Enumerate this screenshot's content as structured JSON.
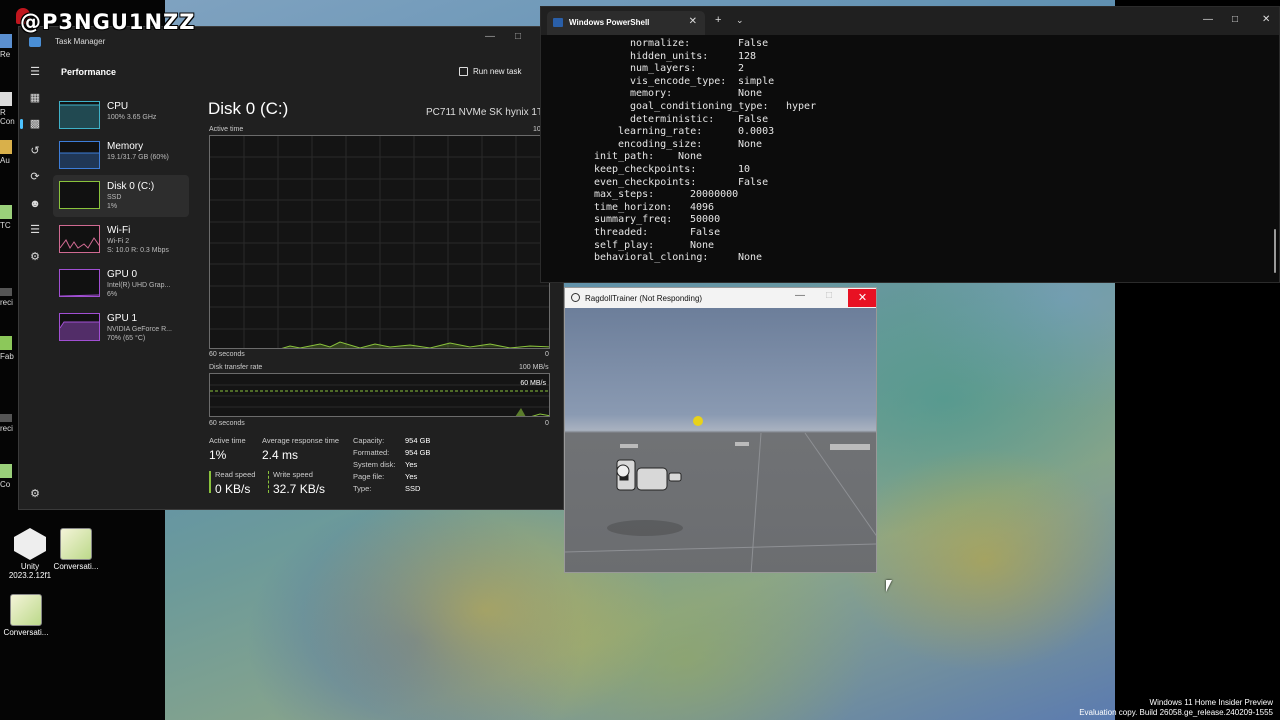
{
  "watermark": {
    "handle": "@P3NGU1NZZ"
  },
  "desktop": {
    "icons": [
      {
        "label_line1": "Unity",
        "label_line2": "2023.2.12f1"
      },
      {
        "label_line1": "Conversati..."
      },
      {
        "label_line1": "Conversati..."
      }
    ],
    "edge_labels": [
      "Re",
      "R",
      "Con",
      "Au",
      "TC",
      "reci",
      "Fab",
      "reci",
      "Co",
      "Cor"
    ]
  },
  "taskmanager": {
    "title": "Task Manager",
    "section": "Performance",
    "run_task": "Run new task",
    "sidebar": [
      {
        "name": "CPU",
        "sub1": "100% 3.65 GHz",
        "sub2": ""
      },
      {
        "name": "Memory",
        "sub1": "19.1/31.7 GB (60%)",
        "sub2": ""
      },
      {
        "name": "Disk 0 (C:)",
        "sub1": "SSD",
        "sub2": "1%"
      },
      {
        "name": "Wi-Fi",
        "sub1": "Wi-Fi 2",
        "sub2": "S: 10.0 R: 0.3 Mbps"
      },
      {
        "name": "GPU 0",
        "sub1": "Intel(R) UHD Grap...",
        "sub2": "6%"
      },
      {
        "name": "GPU 1",
        "sub1": "NVIDIA GeForce R...",
        "sub2": "70% (65 °C)"
      }
    ],
    "detail": {
      "title": "Disk 0 (C:)",
      "model": "PC711 NVMe SK hynix 1T",
      "active_time_label": "Active time",
      "active_max": "100%",
      "seconds_label": "60 seconds",
      "zero": "0",
      "transfer_label": "Disk transfer rate",
      "transfer_max": "100 MB/s",
      "transfer_mark": "60 MB/s",
      "stats": {
        "active_time_label": "Active time",
        "active_time": "1%",
        "avg_resp_label": "Average response time",
        "avg_resp": "2.4 ms",
        "read_label": "Read speed",
        "read": "0 KB/s",
        "write_label": "Write speed",
        "write": "32.7 KB/s"
      },
      "props": [
        {
          "k": "Capacity:",
          "v": "954 GB"
        },
        {
          "k": "Formatted:",
          "v": "954 GB"
        },
        {
          "k": "System disk:",
          "v": "Yes"
        },
        {
          "k": "Page file:",
          "v": "Yes"
        },
        {
          "k": "Type:",
          "v": "SSD"
        }
      ]
    }
  },
  "powershell": {
    "tab": "Windows PowerShell",
    "lines": [
      {
        "k": "normalize:",
        "v": "False",
        "indent": 2
      },
      {
        "k": "hidden_units:",
        "v": "128",
        "indent": 2
      },
      {
        "k": "num_layers:",
        "v": "2",
        "indent": 2
      },
      {
        "k": "vis_encode_type:",
        "v": "simple",
        "indent": 2
      },
      {
        "k": "memory:",
        "v": "None",
        "indent": 2
      },
      {
        "k": "goal_conditioning_type:",
        "v": "hyper",
        "indent": 2
      },
      {
        "k": "deterministic:",
        "v": "False",
        "indent": 2
      },
      {
        "k": "learning_rate:",
        "v": "0.0003",
        "indent": 1
      },
      {
        "k": "encoding_size:",
        "v": "None",
        "indent": 1
      },
      {
        "k": "init_path:",
        "v": "None",
        "indent": 0
      },
      {
        "k": "keep_checkpoints:",
        "v": "10",
        "indent": 0
      },
      {
        "k": "even_checkpoints:",
        "v": "False",
        "indent": 0
      },
      {
        "k": "max_steps:",
        "v": "20000000",
        "indent": 0
      },
      {
        "k": "time_horizon:",
        "v": "4096",
        "indent": 0
      },
      {
        "k": "summary_freq:",
        "v": "50000",
        "indent": 0
      },
      {
        "k": "threaded:",
        "v": "False",
        "indent": 0
      },
      {
        "k": "self_play:",
        "v": "None",
        "indent": 0
      },
      {
        "k": "behavioral_cloning:",
        "v": "None",
        "indent": 0
      }
    ]
  },
  "ragdoll": {
    "title": "RagdollTrainer (Not Responding)"
  },
  "build": {
    "line1": "Windows 11 Home Insider Preview",
    "line2": "Evaluation copy. Build 26058.ge_release.240209-1555"
  },
  "colors": {
    "cpu": "#3fb1c8",
    "memory": "#3d7dd8",
    "disk": "#8ac33c",
    "wifi": "#d06a92",
    "gpu": "#a14fd3",
    "close": "#e81123"
  }
}
